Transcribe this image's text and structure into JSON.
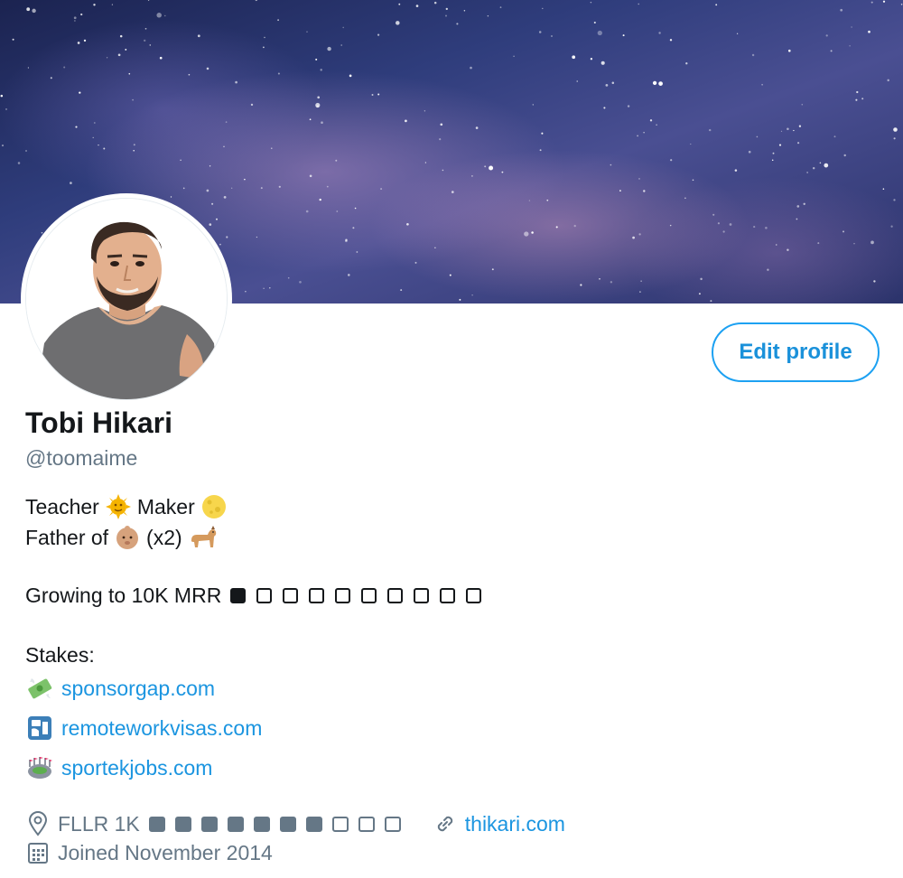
{
  "profile": {
    "name": "Tobi Hikari",
    "handle": "@toomaime",
    "edit_button_label": "Edit profile"
  },
  "bio": {
    "line1_a": "Teacher",
    "line1_emoji1": "sun-face-emoji",
    "line1_b": "Maker",
    "line1_emoji2": "moon-emoji",
    "line2_a": "Father of",
    "line2_emoji1": "baby-emoji",
    "line2_b": "(x2)",
    "line2_emoji2": "dog-emoji",
    "growth_label": "Growing to 10K MRR",
    "growth_progress": {
      "filled": 1,
      "total": 10
    },
    "stakes_label": "Stakes:",
    "stakes": [
      {
        "icon": "money-with-wings-emoji",
        "text": "sponsorgap.com"
      },
      {
        "icon": "passport-control-emoji",
        "text": "remoteworkvisas.com"
      },
      {
        "icon": "stadium-emoji",
        "text": "sportekjobs.com"
      }
    ]
  },
  "meta": {
    "location_icon": "location-pin-icon",
    "location_text": "FLLR 1K",
    "location_progress": {
      "filled": 7,
      "total": 10
    },
    "website_icon": "link-icon",
    "website": "thikari.com",
    "joined_icon": "calendar-icon",
    "joined": "Joined November 2014"
  },
  "colors": {
    "accent": "#1da1f2",
    "link": "#1b95e0",
    "text": "#14171a",
    "secondary": "#657786"
  }
}
